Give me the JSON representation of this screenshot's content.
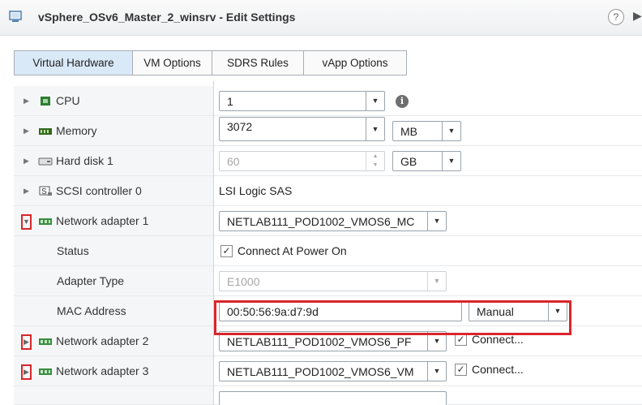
{
  "window": {
    "title": "vSphere_OSv6_Master_2_winsrv - Edit Settings",
    "help_icon": "?",
    "more_icon": "▶|"
  },
  "tabs": [
    {
      "label": "Virtual Hardware",
      "active": true
    },
    {
      "label": "VM Options",
      "active": false
    },
    {
      "label": "SDRS Rules",
      "active": false
    },
    {
      "label": "vApp Options",
      "active": false
    }
  ],
  "hardware": {
    "cpu": {
      "label": "CPU",
      "value": "1",
      "icon": "cpu-icon"
    },
    "memory": {
      "label": "Memory",
      "value": "3072",
      "unit": "MB",
      "icon": "memory-icon"
    },
    "hard_disk": {
      "label": "Hard disk 1",
      "value": "60",
      "unit": "GB",
      "icon": "hard-disk-icon"
    },
    "scsi": {
      "label": "SCSI controller 0",
      "value": "LSI Logic SAS",
      "icon": "scsi-icon"
    },
    "nic1": {
      "label": "Network adapter 1",
      "network": "NETLAB111_POD1002_VMOS6_MC",
      "status_label": "Status",
      "status_value": "Connect At Power On",
      "adapter_type_label": "Adapter Type",
      "adapter_type_value": "E1000",
      "mac_label": "MAC Address",
      "mac_value": "00:50:56:9a:d7:9d",
      "mac_mode": "Manual"
    },
    "nic2": {
      "label": "Network adapter 2",
      "network": "NETLAB111_POD1002_VMOS6_PF",
      "connect": "Connect..."
    },
    "nic3": {
      "label": "Network adapter 3",
      "network": "NETLAB111_POD1002_VMOS6_VM",
      "connect": "Connect..."
    }
  },
  "glyphs": {
    "caret_right": "▶",
    "caret_down": "▼",
    "dropdown": "▼",
    "spin_up": "▲",
    "spin_down": "▼",
    "check": "✓",
    "info": "i"
  },
  "colors": {
    "highlight": "#d9262b",
    "tab_active": "#d9e9f7",
    "label_bg": "#f5f6f7"
  }
}
